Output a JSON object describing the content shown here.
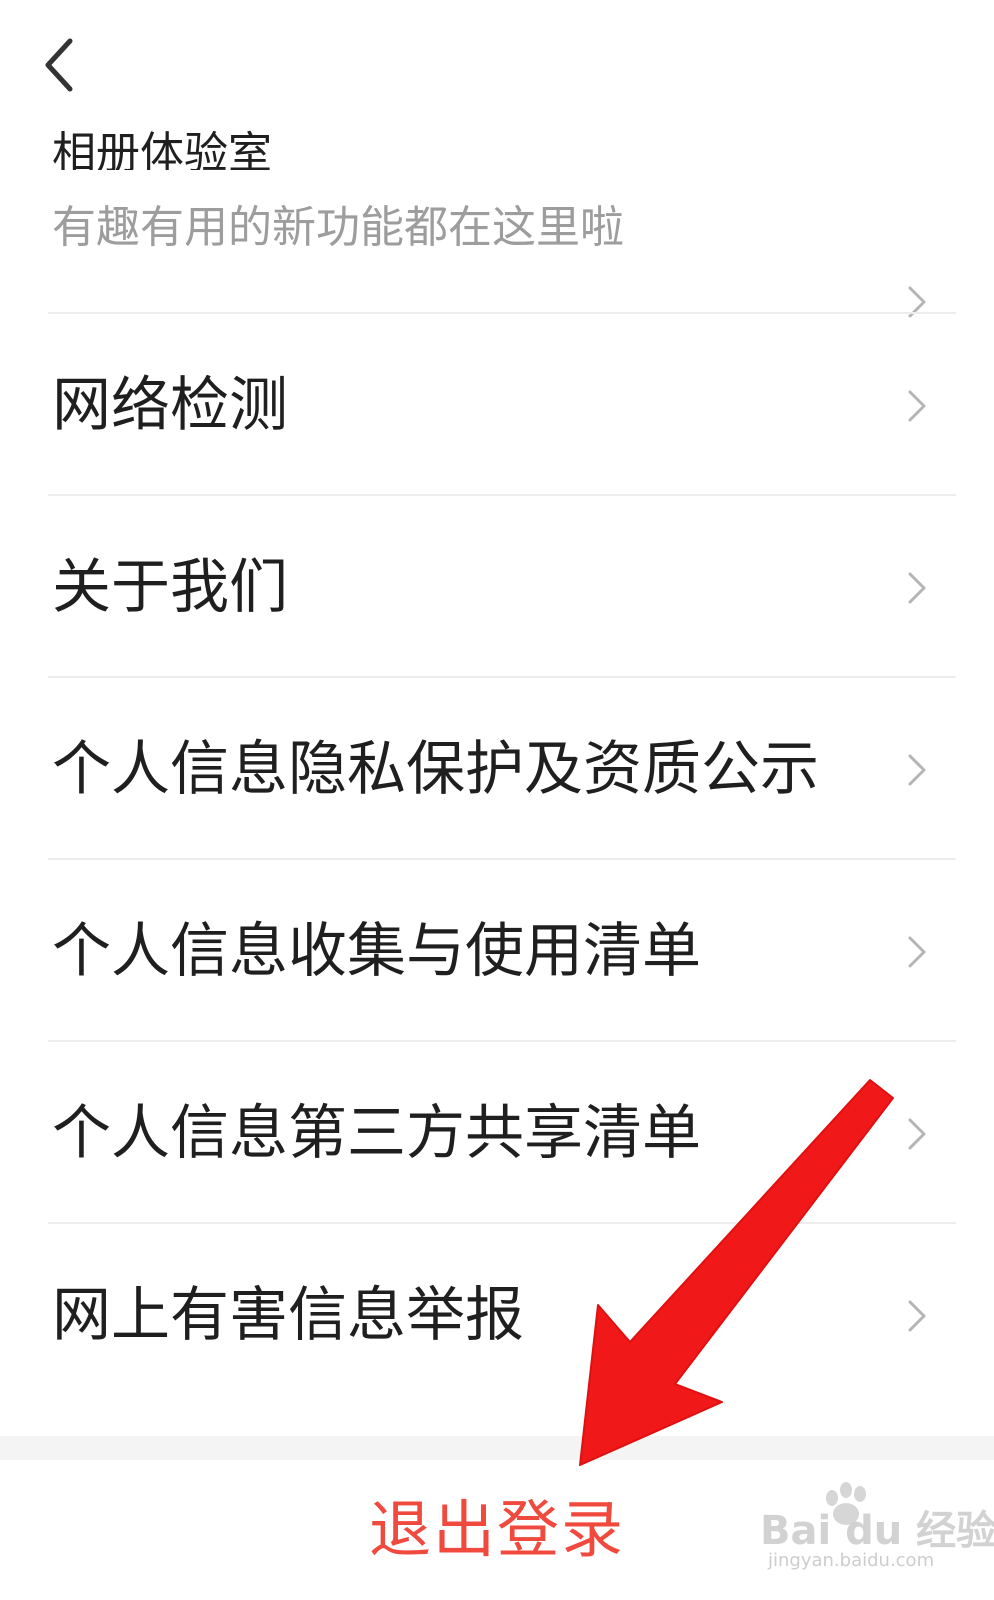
{
  "header": {
    "back_icon": "chevron-left-icon"
  },
  "settings": {
    "first_item": {
      "title": "相册体验室",
      "subtitle": "有趣有用的新功能都在这里啦"
    },
    "items": [
      {
        "label": "网络检测"
      },
      {
        "label": "关于我们"
      },
      {
        "label": "个人信息隐私保护及资质公示"
      },
      {
        "label": "个人信息收集与使用清单"
      },
      {
        "label": "个人信息第三方共享清单"
      },
      {
        "label": "网上有害信息举报"
      }
    ],
    "chevron_icon": "chevron-right-icon"
  },
  "footer": {
    "logout_label": "退出登录",
    "logout_color": "#f04a3f"
  },
  "annotation": {
    "arrow_color": "#f01818"
  },
  "watermark": {
    "main": "Bai du 经验",
    "sub": "jingyan.baidu.com"
  }
}
